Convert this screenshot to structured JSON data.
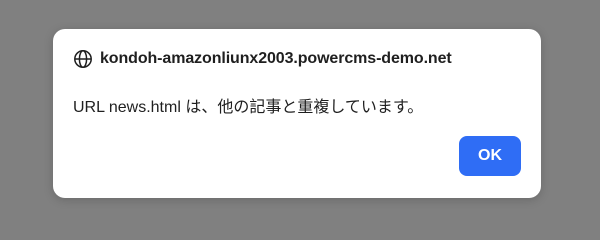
{
  "dialog": {
    "origin": "kondoh-amazonliunx2003.powercms-demo.net",
    "origin_icon": "globe-icon",
    "message": "URL news.html は、他の記事と重複しています。",
    "ok_label": "OK"
  },
  "colors": {
    "overlay": "#808080",
    "dialog_background": "#ffffff",
    "button_accent": "#2f6df5",
    "text": "#1f1f1f"
  }
}
